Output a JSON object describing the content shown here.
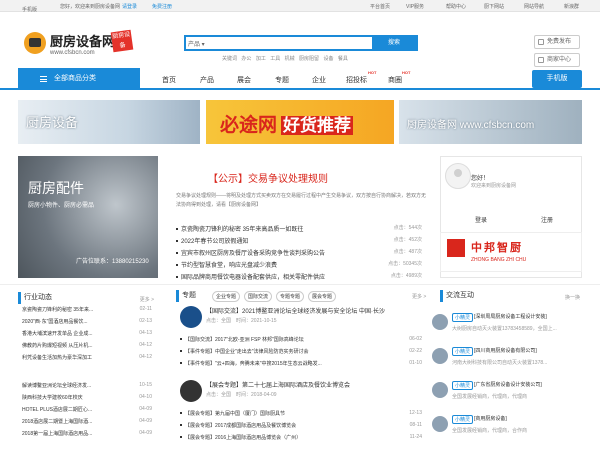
{
  "topbar": {
    "mobile": "手机版",
    "greeting": "您好，欢迎来到厨房设备网",
    "login": "请登录",
    "register": "免费注册",
    "links": [
      "平台首页",
      "VIP服务",
      "帮助中心",
      "厨下网站",
      "网站导航",
      "新浪群"
    ]
  },
  "logo": {
    "name": "厨房设备网",
    "badge": "厨房设备",
    "url": "www.cfsbcn.com"
  },
  "search": {
    "select": "产品",
    "placeholder": "",
    "button": "搜索",
    "hotwords": [
      "关键词",
      "办公",
      "加工",
      "工具",
      "机械",
      "厨房阻留",
      "设备",
      "餐具"
    ]
  },
  "side_buttons": {
    "free_publish": "免费发布",
    "buyer_center": "商家中心"
  },
  "nav": {
    "all_categories": "全部商品分类",
    "items": [
      "首页",
      "产品",
      "展会",
      "专题",
      "企业",
      "招投标",
      "商圈"
    ],
    "hot": "HOT",
    "mobile": "手机版"
  },
  "banners": {
    "b1": "厨房设备",
    "b2_main": "必途网",
    "b2_highlight": "好货推荐",
    "b3": "厨房设备网 www.cfsbcn.com"
  },
  "promo": {
    "title": "厨房配件",
    "subtitle": "厨房小物件、厨房必需品",
    "ad": "广告位联系：13880215230"
  },
  "notice": {
    "title": "【公示】交易争议处理规则",
    "body": "交易争议处理规则——将明及处理方式买卖双方在交易履行过程中产生交易争议，双方按自行协商解决，若双方无法协商得到处理，请看【厨房设备网】"
  },
  "news": [
    {
      "title": "京瓷陶瓷刀锋利的秘密 35年来高品质一如既往",
      "hits": "点击：544次"
    },
    {
      "title": "2022年春节公司放假通知",
      "hits": "点击：452次"
    },
    {
      "title": "宜宾市叙州区厨房及餐厅设备采购竞争性谈判采购公告",
      "hits": "点击：487次"
    },
    {
      "title": "节约型智慧食堂，响应光盘减少浪费",
      "hits": "点击：50345次"
    },
    {
      "title": "国际品牌商用餐饮电器设备配套供应，相关零配件供应",
      "hits": "点击：4989次"
    }
  ],
  "login_box": {
    "hello": "您好！",
    "desc": "欢迎来到厨房设备网",
    "login": "登录",
    "register": "注册"
  },
  "zbzc": {
    "name": "中邦智厨",
    "en": "ZHONG BANG ZHI CHU"
  },
  "industry": {
    "title": "行业动态",
    "more": "更多 >",
    "items": [
      {
        "t": "京瓷陶瓷刀锋利的秘密 35年来...",
        "d": "02-11"
      },
      {
        "t": "2020\"西·东\"国酒店用品餐饮...",
        "d": "02-13"
      },
      {
        "t": "香港大埔滨速开发单品 企业成...",
        "d": "04-13"
      },
      {
        "t": "佛教药片购爆短视频 从压片机...",
        "d": "04-12"
      },
      {
        "t": "利凭设备生活加热为豪华深加工",
        "d": "04-12"
      },
      {
        "t": "解读博鳌亚洲论坛全球经济发...",
        "d": "10-15"
      },
      {
        "t": "陕西科技大学建校60年校庆",
        "d": "04-10"
      },
      {
        "t": "HOTEL PLUS酒店展二期匠心...",
        "d": "04-09"
      },
      {
        "t": "2018酒店展二期暨上海国际酒...",
        "d": "04-09"
      },
      {
        "t": "2018第一届上海国际酒店用品...",
        "d": "04-09"
      }
    ]
  },
  "topics": {
    "title": "专题",
    "more": "更多 >",
    "tags": [
      "企业专题",
      "国际交流",
      "专题专题",
      "展会专题"
    ],
    "feature1": {
      "title": "【国际交流】2021博鳌亚洲论坛全球经济发展与安全论坛 中国·长沙",
      "meta": "点击：全国　时间：2021-10-15"
    },
    "list1": [
      {
        "t": "【国际交流】2017\"北欧-亚洲 FSP 林邦\"国际高峰论坛",
        "d": "06-02"
      },
      {
        "t": "【事件专题】中国企业\"走出去\"法律风险防范实务研讨会",
        "d": "02-22"
      },
      {
        "t": "【事件专题】\"云+四海，奔腾未来\"中搜2015年生态云战略发...",
        "d": "01-10"
      }
    ],
    "feature2": {
      "title": "【展会专题】第二十七届上海国际酒店及餐饮业博览会",
      "meta": "点击：全国　时间：2018-04-09"
    },
    "list2": [
      {
        "t": "【展会专题】第九届中国（厦门）国际厨具节",
        "d": "12-13"
      },
      {
        "t": "【展会专题】2017成都国际酒店用品及餐饮博览会",
        "d": "08-11"
      },
      {
        "t": "【展会专题】2016上海国际酒店用品博览会（广州）",
        "d": "11-24"
      }
    ]
  },
  "exchange": {
    "title": "交流互动",
    "more": "换一换",
    "items": [
      {
        "u": "小精灵",
        "q": "[深圳周局厨房设备工程设计安装]",
        "a": "大树厨房自动灭火装置13783458589，全国上..."
      },
      {
        "u": "小精灵",
        "q": "[四川商用厨房设备有限公司]",
        "a": "河南大树科技有限公司自动灭火装置1378..."
      },
      {
        "u": "小精灵",
        "q": "[广东省厨房设备设计安装公司]",
        "a": "全国发展经销商，代理商，代理商"
      },
      {
        "u": "小精灵",
        "q": "[商用厨房设备]",
        "a": "全国发展经销商，代理商，合作商"
      }
    ]
  }
}
